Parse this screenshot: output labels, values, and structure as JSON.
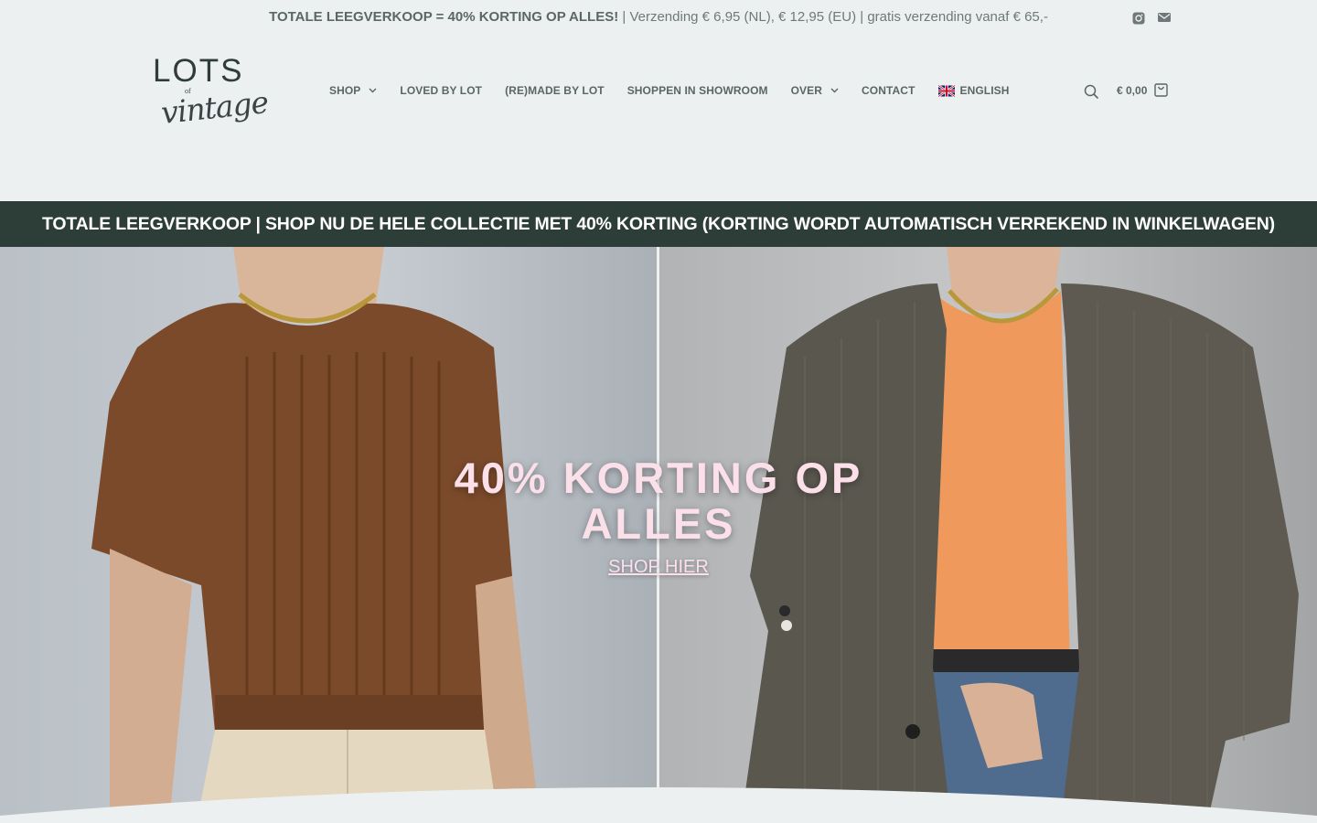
{
  "topbar": {
    "promo_bold": "TOTALE LEEGVERKOOP = 40% KORTING OP ALLES!",
    "promo_rest": " | Verzending € 6,95 (NL), € 12,95 (EU) | gratis verzending vanaf € 65,-",
    "icons": [
      "instagram-icon",
      "mail-icon"
    ]
  },
  "logo": {
    "line1": "LOTS",
    "line2": "of",
    "line3": "vintage"
  },
  "nav": {
    "items": [
      {
        "label": "SHOP",
        "has_dropdown": true
      },
      {
        "label": "LOVED BY LOT",
        "has_dropdown": false
      },
      {
        "label": "(RE)MADE BY LOT",
        "has_dropdown": false
      },
      {
        "label": "SHOPPEN IN SHOWROOM",
        "has_dropdown": false
      },
      {
        "label": "OVER",
        "has_dropdown": true
      },
      {
        "label": "CONTACT",
        "has_dropdown": false
      }
    ],
    "language": {
      "label": "ENGLISH",
      "icon": "uk-flag-icon"
    }
  },
  "cart": {
    "total": "€ 0,00",
    "icon": "shopping-bag-icon"
  },
  "search": {
    "icon": "search-icon"
  },
  "banner": {
    "text": "TOTALE LEEGVERKOOP | SHOP NU DE HELE COLLECTIE MET 40% KORTING (KORTING WORDT AUTOMATISCH VERREKEND IN WINKELWAGEN)"
  },
  "hero": {
    "title_line1": "40% KORTING OP",
    "title_line2": "ALLES",
    "cta": "SHOP HIER"
  },
  "colors": {
    "background": "#edf0f0",
    "nav_text": "#5a6565",
    "banner_bg": "#2d3d38",
    "hero_text": "#fbe0ea"
  }
}
